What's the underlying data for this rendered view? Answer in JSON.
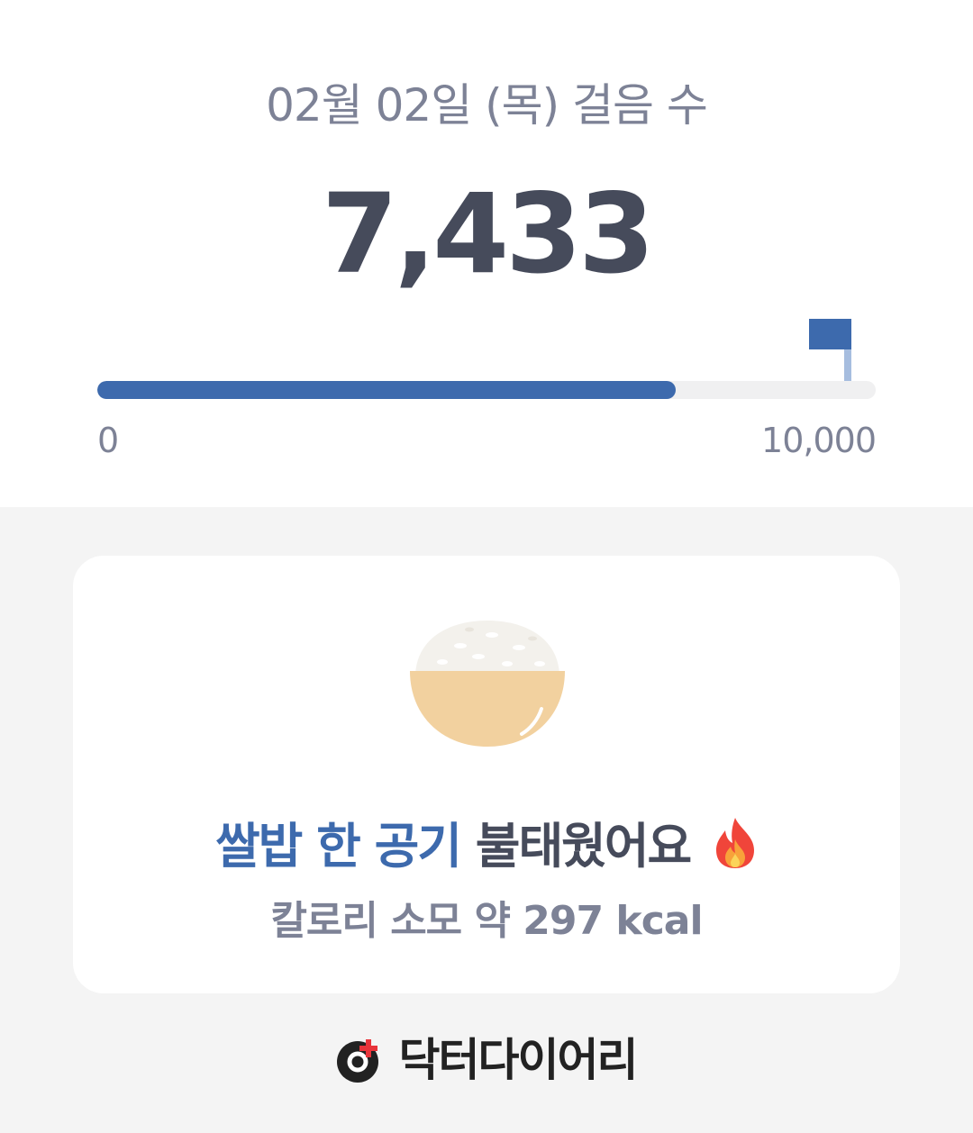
{
  "header": {
    "date_title": "02월 02일 (목) 걸음 수",
    "step_count": "7,433"
  },
  "progress": {
    "steps": 7433,
    "goal": 10000,
    "min_label": "0",
    "max_label": "10,000",
    "flag_icon": "goal-flag-icon",
    "fill_color": "#3d6aad",
    "track_color": "#f0f0f1"
  },
  "card": {
    "food_icon": "rice-bowl-icon",
    "food_name": "쌀밥 한 공기",
    "burned_text": "불태웠어요",
    "fire_icon": "fire-icon",
    "calorie_text": "칼로리 소모 약 297 kcal"
  },
  "brand": {
    "logo_icon": "doctor-diary-logo-icon",
    "name": "닥터다이어리"
  },
  "colors": {
    "accent": "#3d6aad",
    "text_dark": "#464b5b",
    "text_muted": "#7d8296",
    "background": "#f4f4f4",
    "brand_red": "#e8343a"
  }
}
